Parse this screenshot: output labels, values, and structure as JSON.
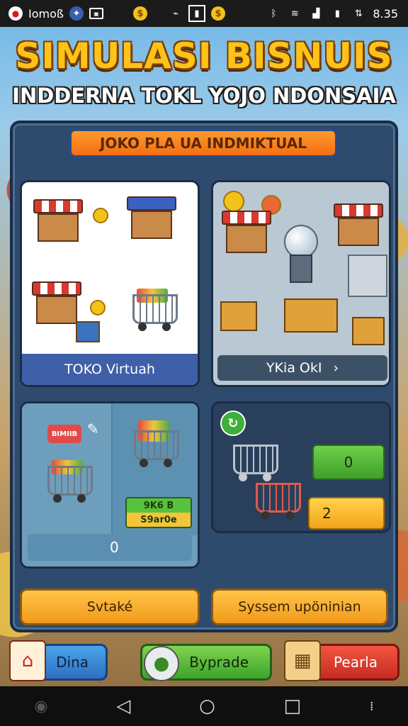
{
  "status_bar": {
    "app_label": "Iomoß",
    "time": "8.35",
    "left_icons": [
      "record-icon",
      "shield-icon",
      "image-icon",
      "coin-icon",
      "usb-icon",
      "news-icon",
      "coin-icon"
    ],
    "right_icons": [
      "bluetooth-icon",
      "wifi-icon",
      "signal-icon",
      "battery-icon",
      "data-icon"
    ]
  },
  "header": {
    "title": "SIMULASI BISNUIS",
    "subtitle": "INDDERNA TOKL YOJO NDONSAIA"
  },
  "panel": {
    "banner": "JOKO PLA UA INDMIKTUAL",
    "cards": [
      {
        "label": "TOKO Virtuah"
      },
      {
        "label": "YKia OkI",
        "arrow": "›"
      },
      {
        "value": "0",
        "tag": "BIMIIB",
        "badge_top": "9K6 B",
        "badge_bottom": "S9ar0e"
      },
      {
        "green_value": "0",
        "yellow_value": "2"
      }
    ],
    "buttons": {
      "left": "Svtaké",
      "right": "Syssem upöninian"
    }
  },
  "bottom_buttons": [
    {
      "label": "Dina",
      "icon": "house-icon"
    },
    {
      "label": "Byprade",
      "icon": "piggy-bank-icon"
    },
    {
      "label": "Pearla",
      "icon": "box-icon"
    }
  ],
  "nav": {
    "icons": [
      "back-icon",
      "home-icon",
      "recents-icon",
      "menu-icon"
    ]
  },
  "colors": {
    "title": "#ffc21a",
    "panel": "#2e4a6c",
    "banner": "#f46e12"
  }
}
